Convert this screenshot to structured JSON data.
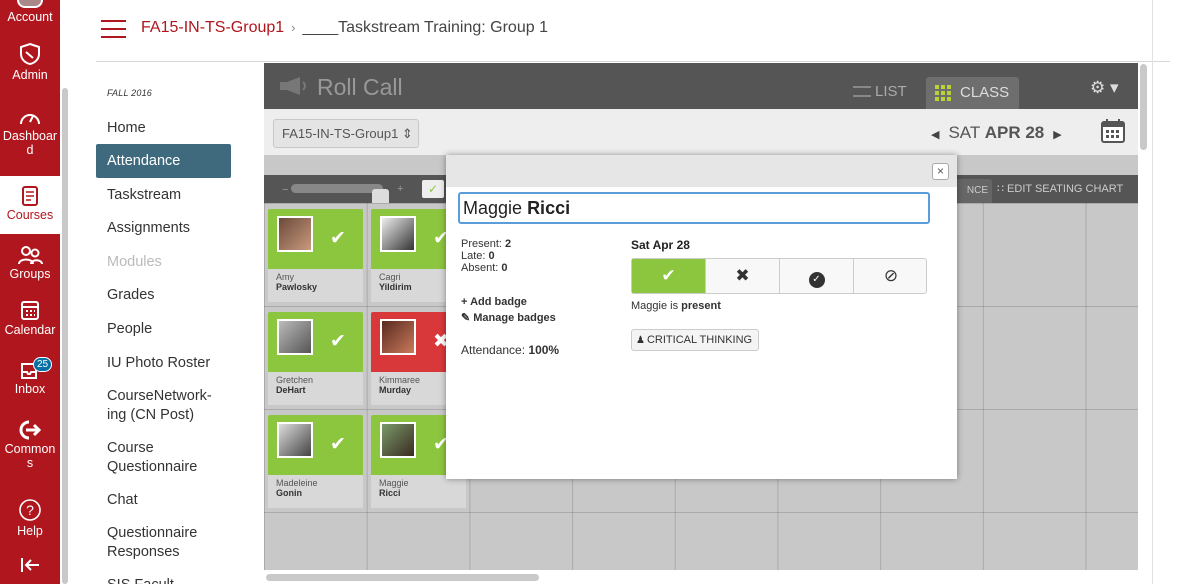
{
  "global_nav": {
    "account": "Account",
    "admin": "Admin",
    "dashboard_line1": "Dashboar",
    "dashboard_line2": "d",
    "courses": "Courses",
    "groups": "Groups",
    "calendar": "Calendar",
    "inbox": "Inbox",
    "inbox_count": "25",
    "commons_line1": "Common",
    "commons_line2": "s",
    "help": "Help"
  },
  "breadcrumbs": {
    "course": "FA15-IN-TS-Group1",
    "page": "____Taskstream Training: Group 1"
  },
  "course_nav": {
    "term": "FALL 2016",
    "items": [
      {
        "label": "Home"
      },
      {
        "label": "Attendance"
      },
      {
        "label": "Taskstream"
      },
      {
        "label": "Assignments"
      },
      {
        "label": "Modules"
      },
      {
        "label": "Grades"
      },
      {
        "label": "People"
      },
      {
        "label": "IU Photo Roster"
      },
      {
        "label": "CourseNetwork-ing (CN Post)"
      },
      {
        "label": "Course Questionnaire"
      },
      {
        "label": "Chat"
      },
      {
        "label": "Questionnaire Responses"
      },
      {
        "label": "SIS Facult"
      }
    ]
  },
  "roll_call": {
    "title": "Roll Call",
    "list_label": "LIST",
    "class_label": "CLASS",
    "section": "FA15-IN-TS-Group1 ⇕",
    "date_prefix": "SAT",
    "date_main": "APR 28",
    "attendance_tab": "NCE",
    "seating_chart": "∷ EDIT SEATING CHART",
    "students": [
      {
        "first": "Amy",
        "last": "Pawlosky",
        "status": "present"
      },
      {
        "first": "Cagri",
        "last": "Yildirim",
        "status": "present"
      },
      {
        "first": "Gretchen",
        "last": "DeHart",
        "status": "present"
      },
      {
        "first": "Kimmaree",
        "last": "Murday",
        "status": "absent"
      },
      {
        "first": "Madeleine",
        "last": "Gonin",
        "status": "present"
      },
      {
        "first": "Maggie",
        "last": "Ricci",
        "status": "present"
      }
    ]
  },
  "modal": {
    "first_name": "Maggie",
    "last_name": "Ricci",
    "present_label": "Present:",
    "present_count": "2",
    "late_label": "Late:",
    "late_count": "0",
    "absent_label": "Absent:",
    "absent_count": "0",
    "add_badge": "+ Add badge",
    "manage_badges": "✎ Manage badges",
    "attendance_label": "Attendance:",
    "attendance_pct": "100%",
    "day": "Sat Apr 28",
    "status_msg_prefix": "Maggie is",
    "status_msg_value": "present",
    "badge": "CRITICAL THINKING",
    "close": "×"
  },
  "colors": {
    "brand": "#b0161d",
    "present": "#8cc63f",
    "absent": "#d9383a",
    "active_nav": "#3f6a7e"
  }
}
